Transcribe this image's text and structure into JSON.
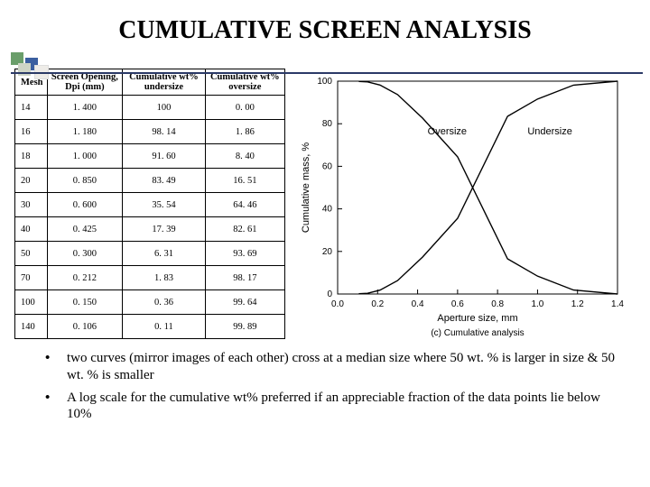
{
  "title": "CUMULATIVE SCREEN ANALYSIS",
  "table": {
    "headers": [
      "Mesh",
      "Screen Opening, Dpi (mm)",
      "Cumulative wt% undersize",
      "Cumulative wt% oversize"
    ],
    "rows": [
      [
        "14",
        "1. 400",
        "100",
        "0. 00"
      ],
      [
        "16",
        "1. 180",
        "98. 14",
        "1. 86"
      ],
      [
        "18",
        "1. 000",
        "91. 60",
        "8. 40"
      ],
      [
        "20",
        "0. 850",
        "83. 49",
        "16. 51"
      ],
      [
        "30",
        "0. 600",
        "35. 54",
        "64. 46"
      ],
      [
        "40",
        "0. 425",
        "17. 39",
        "82. 61"
      ],
      [
        "50",
        "0. 300",
        "6. 31",
        "93. 69"
      ],
      [
        "70",
        "0. 212",
        "1. 83",
        "98. 17"
      ],
      [
        "100",
        "0. 150",
        "0. 36",
        "99. 64"
      ],
      [
        "140",
        "0. 106",
        "0. 11",
        "99. 89"
      ]
    ]
  },
  "chart_data": {
    "type": "line",
    "xlabel": "Aperture size, mm",
    "ylabel": "Cumulative mass, %",
    "caption": "(c) Cumulative analysis",
    "xlim": [
      0.0,
      1.4
    ],
    "ylim": [
      0,
      100
    ],
    "xticks": [
      0.0,
      0.2,
      0.4,
      0.6,
      0.8,
      1.0,
      1.2,
      1.4
    ],
    "yticks": [
      0,
      20,
      40,
      60,
      80,
      100
    ],
    "series": [
      {
        "name": "Oversize",
        "x": [
          0.106,
          0.15,
          0.212,
          0.3,
          0.425,
          0.6,
          0.85,
          1.0,
          1.18,
          1.4
        ],
        "y": [
          99.89,
          99.64,
          98.17,
          93.69,
          82.61,
          64.46,
          16.51,
          8.4,
          1.86,
          0.0
        ]
      },
      {
        "name": "Undersize",
        "x": [
          0.106,
          0.15,
          0.212,
          0.3,
          0.425,
          0.6,
          0.85,
          1.0,
          1.18,
          1.4
        ],
        "y": [
          0.11,
          0.36,
          1.83,
          6.31,
          17.39,
          35.54,
          83.49,
          91.6,
          98.14,
          100.0
        ]
      }
    ],
    "annotations": [
      {
        "text": "Oversize",
        "x": 0.45,
        "y": 75
      },
      {
        "text": "Undersize",
        "x": 0.95,
        "y": 75
      }
    ]
  },
  "bullets": [
    "two curves (mirror images of each other) cross at a median size where 50 wt. % is larger in size & 50 wt. % is smaller",
    "A log scale for the cumulative wt% preferred if an appreciable fraction of the data points lie below 10%"
  ]
}
